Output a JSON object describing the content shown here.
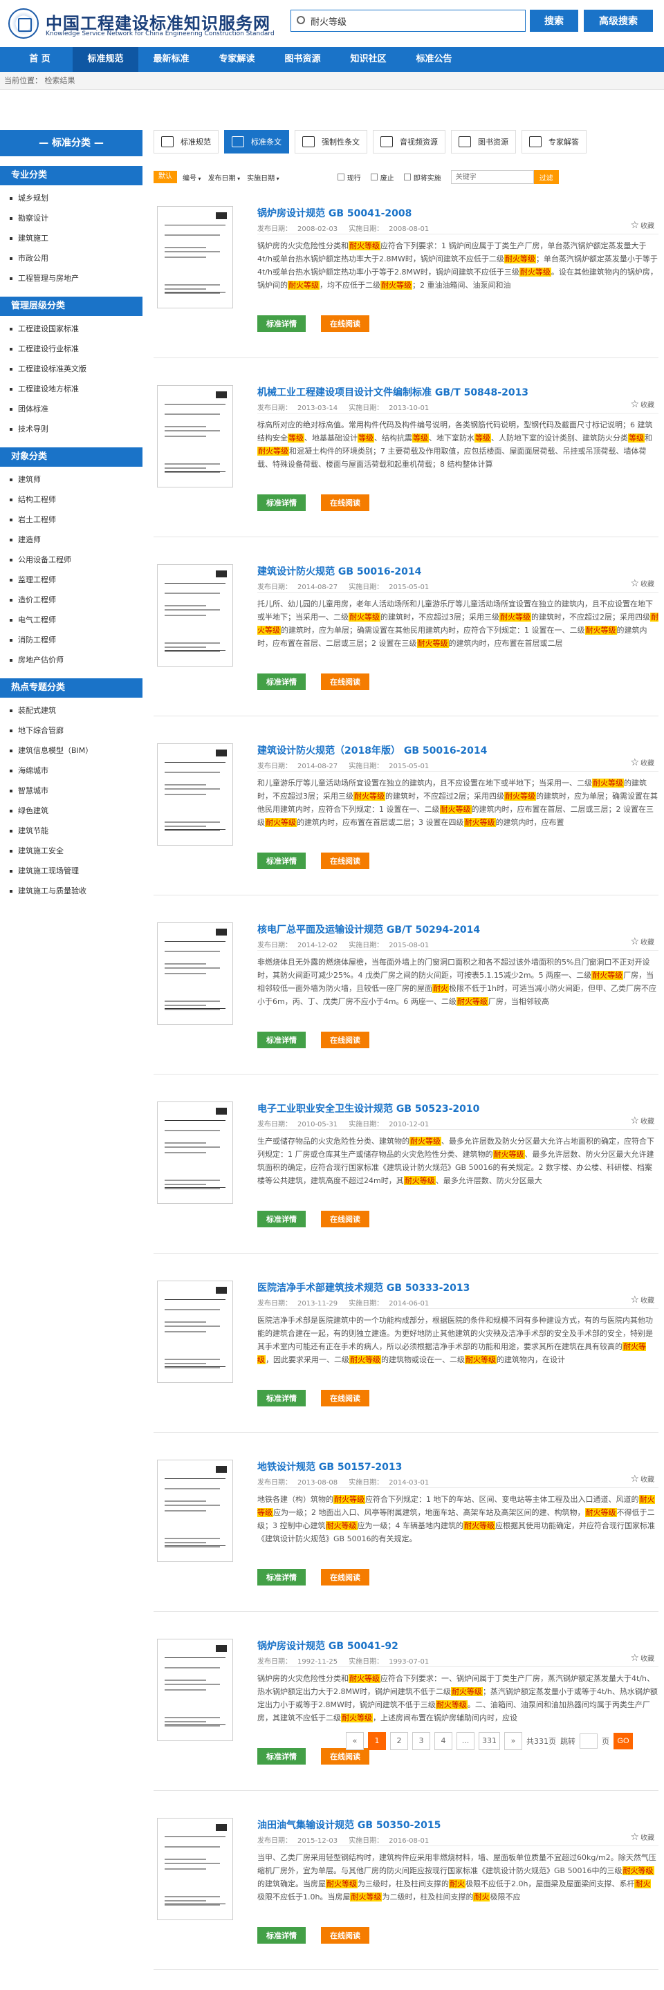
{
  "header": {
    "title": "中国工程建设标准知识服务网",
    "subtitle": "Knowledge Service Network for China Engineering Construction Standard",
    "search_value": "耐火等级",
    "search_btn": "搜索",
    "adv_btn": "高级搜索"
  },
  "nav": [
    "首 页",
    "标准规范",
    "最新标准",
    "专家解读",
    "图书资源",
    "知识社区",
    "标准公告"
  ],
  "breadcrumb": "当前位置： 检索结果",
  "sidebar": {
    "head": "— 标准分类 —",
    "groups": [
      {
        "name": "专业分类",
        "items": [
          "城乡规划",
          "勘察设计",
          "建筑施工",
          "市政公用",
          "工程管理与房地产"
        ]
      },
      {
        "name": "管理层级分类",
        "items": [
          "工程建设国家标准",
          "工程建设行业标准",
          "工程建设标准英文版",
          "工程建设地方标准",
          "团体标准",
          "技术导则"
        ]
      },
      {
        "name": "对象分类",
        "items": [
          "建筑师",
          "结构工程师",
          "岩土工程师",
          "建造师",
          "公用设备工程师",
          "监理工程师",
          "造价工程师",
          "电气工程师",
          "消防工程师",
          "房地产估价师"
        ]
      },
      {
        "name": "热点专题分类",
        "items": [
          "装配式建筑",
          "地下综合管廊",
          "建筑信息模型（BIM）",
          "海绵城市",
          "智慧城市",
          "绿色建筑",
          "建筑节能",
          "建筑施工安全",
          "建筑施工现场管理",
          "建筑施工与质量验收"
        ]
      }
    ]
  },
  "tabs": [
    "标准规范",
    "标准条文",
    "强制性条文",
    "音视频资源",
    "图书资源",
    "专家解答"
  ],
  "filter": {
    "default": "默认",
    "sort1": "编号",
    "sort2": "发布日期",
    "sort3": "实施日期",
    "c1": "现行",
    "c2": "废止",
    "c3": "即将实施",
    "placeholder": "关键字",
    "btn": "过滤"
  },
  "labels": {
    "pub": "发布日期：",
    "impl": "实施日期：",
    "fav": "收藏",
    "detail": "标准详情",
    "read": "在线阅读"
  },
  "results": [
    {
      "title": "锅炉房设计规范 GB 50041-2008",
      "pub": "2008-02-03",
      "impl": "2008-08-01",
      "abs": [
        "锅炉房的火灾危险性分类和",
        "耐火等级",
        "应符合下列要求：1 锅炉间应属于丁类生产厂房，单台蒸汽锅炉额定蒸发量大于4t/h或单台热水锅炉额定热功率大于2.8MW时，锅炉间建筑不应低于二级",
        "耐火等级",
        "；单台蒸汽锅炉额定蒸发量小于等于4t/h或单台热水锅炉额定热功率小于等于2.8MW时，锅炉间建筑不应低于三级",
        "耐火等级",
        "。设在其他建筑物内的锅炉房，锅炉间的",
        "耐火等级",
        "，均不应低于二级",
        "耐火等级",
        "；2 重油油箱间、油泵间和油"
      ]
    },
    {
      "title": "机械工业工程建设项目设计文件编制标准 GB/T 50848-2013",
      "pub": "2013-03-14",
      "impl": "2013-10-01",
      "abs": [
        "标高所对应的绝对标高值。常用构件代码及构件编号说明，各类钢筋代码说明，型钢代码及截面尺寸标记说明；6 建筑结构安全",
        "等级",
        "、地基基础设计",
        "等级",
        "、结构抗震",
        "等级",
        "、地下室防水",
        "等级",
        "、人防地下室的设计类别、建筑防火分类",
        "等级",
        "和",
        "耐火等级",
        "和混凝土构件的环境类别；7 主要荷载及作用取值，应包括楼面、屋面面层荷载、吊挂或吊顶荷载、墙体荷载、特殊设备荷载、楼面与屋面活荷载和起重机荷载；8 结构整体计算"
      ]
    },
    {
      "title": "建筑设计防火规范 GB 50016-2014",
      "pub": "2014-08-27",
      "impl": "2015-05-01",
      "abs": [
        "托儿所、幼儿园的儿童用房，老年人活动场所和儿童游乐厅等儿童活动场所宜设置在独立的建筑内，且不应设置在地下或半地下；当采用一、二级",
        "耐火等级",
        "的建筑时，不应超过3层；采用三级",
        "耐火等级",
        "的建筑时，不应超过2层；采用四级",
        "耐火等级",
        "的建筑时，应为单层；确需设置在其他民用建筑内时，应符合下列规定：1 设置在一、二级",
        "耐火等级",
        "的建筑内时，应布置在首层、二层或三层；2 设置在三级",
        "耐火等级",
        "的建筑内时，应布置在首层或二层"
      ]
    },
    {
      "title": "建筑设计防火规范（2018年版） GB 50016-2014",
      "pub": "2014-08-27",
      "impl": "2015-05-01",
      "abs": [
        "和儿童游乐厅等儿童活动场所宜设置在独立的建筑内，且不应设置在地下或半地下；当采用一、二级",
        "耐火等级",
        "的建筑时，不应超过3层；采用三级",
        "耐火等级",
        "的建筑时，不应超过2层；采用四级",
        "耐火等级",
        "的建筑时，应为单层；确需设置在其他民用建筑内时，应符合下列规定：1 设置在一、二级",
        "耐火等级",
        "的建筑内时，应布置在首层、二层或三层；2 设置在三级",
        "耐火等级",
        "的建筑内时，应布置在首层或二层；3 设置在四级",
        "耐火等级",
        "的建筑内时，应布置"
      ]
    },
    {
      "title": "核电厂总平面及运输设计规范 GB/T 50294-2014",
      "pub": "2014-12-02",
      "impl": "2015-08-01",
      "abs": [
        "非燃烧体且无外露的燃烧体屋檐，当每面外墙上的门窗洞口面积之和各不超过该外墙面积的5%且门窗洞口不正对开设时，其防火间距可减少25%。4 戊类厂房之间的防火间距，可按表5.1.15减少2m。5 两座一、二级",
        "耐火等级",
        "厂房，当相邻较低一面外墙为防火墙，且较低一座厂房的屋面",
        "耐火",
        "极限不低于1h时，可适当减小防火间距，但甲、乙类厂房不应小于6m，丙、丁、戊类厂房不应小于4m。6 两座一、二级",
        "耐火等级",
        "厂房，当相邻较高"
      ]
    },
    {
      "title": "电子工业职业安全卫生设计规范 GB 50523-2010",
      "pub": "2010-05-31",
      "impl": "2010-12-01",
      "abs": [
        "生产或储存物品的火灾危险性分类、建筑物的",
        "耐火等级",
        "、最多允许层数及防火分区最大允许占地面积的确定，应符合下列规定：1 厂房或仓库其生产或储存物品的火灾危险性分类、建筑物的",
        "耐火等级",
        "、最多允许层数、防火分区最大允许建筑面积的确定，应符合现行国家标准《建筑设计防火规范》GB 50016的有关规定。2 数字楼、办公楼、科研楼、档案楼等公共建筑，建筑高度不超过24m时，其",
        "耐火等级",
        "、最多允许层数、防火分区最大"
      ]
    },
    {
      "title": "医院洁净手术部建筑技术规范 GB 50333-2013",
      "pub": "2013-11-29",
      "impl": "2014-06-01",
      "abs": [
        "医院洁净手术部是医院建筑中的一个功能构成部分，根据医院的条件和规模不同有多种建设方式，有的与医院内其他功能的建筑合建在一起，有的则独立建造。为更好地防止其他建筑的火灾殃及洁净手术部的安全及手术部的安全，特别是其手术室内可能还有正在手术的病人，所以必须根据洁净手术部的功能和用途，要求其所在建筑在具有较高的",
        "耐火等级",
        "，因此要求采用一、二级",
        "耐火等级",
        "的建筑物或设在一、二级",
        "耐火等级",
        "的建筑物内，在设计"
      ]
    },
    {
      "title": "地铁设计规范 GB 50157-2013",
      "pub": "2013-08-08",
      "impl": "2014-03-01",
      "abs": [
        "地铁各建（构）筑物的",
        "耐火等级",
        "应符合下列规定：1 地下的车站、区间、变电站等主体工程及出入口通道、风道的",
        "耐火等级",
        "应为一级；2 地面出入口、风亭等附属建筑，地面车站、高架车站及高架区间的建、构筑物，",
        "耐火等级",
        "不得低于二级；3 控制中心建筑",
        "耐火等级",
        "应为一级；4 车辆基地内建筑的",
        "耐火等级",
        "应根据其使用功能确定，并应符合现行国家标准《建筑设计防火规范》GB 50016的有关规定。"
      ]
    },
    {
      "title": "锅炉房设计规范 GB 50041-92",
      "pub": "1992-11-25",
      "impl": "1993-07-01",
      "abs": [
        "锅炉房的火灾危险性分类和",
        "耐火等级",
        "应符合下列要求：一、锅炉间属于丁类生产厂房，蒸汽锅炉额定蒸发量大于4t/h、热水锅炉额定出力大于2.8MW时，锅炉间建筑不低于二级",
        "耐火等级",
        "；蒸汽锅炉额定蒸发量小于或等于4t/h、热水锅炉额定出力小于或等于2.8MW时，锅炉间建筑不低于三级",
        "耐火等级",
        "。二、油箱间、油泵间和油加热器间均属于丙类生产厂房，其建筑不应低于二级",
        "耐火等级",
        "，上述房间布置在锅炉房辅助间内时，应设"
      ]
    },
    {
      "title": "油田油气集输设计规范 GB 50350-2015",
      "pub": "2015-12-03",
      "impl": "2016-08-01",
      "abs": [
        "当甲、乙类厂房采用轻型钢结构时，建筑构件应采用非燃烧材料，墙、屋面板单位质量不宜超过60kg/m2。除天然气压缩机厂房外，宜为单层。与其他厂房的防火间距应按现行国家标准《建筑设计防火规范》GB 50016中的三级",
        "耐火等级",
        "的建筑确定。当房屋",
        "耐火等级",
        "为三级时，柱及柱间支撑的",
        "耐火",
        "极限不应低于2.0h，屋面梁及屋面梁间支撑、系杆",
        "耐火",
        "极限不应低于1.0h。当房屋",
        "耐火等级",
        "为二级时，柱及柱间支撑的",
        "耐火",
        "极限不应"
      ]
    }
  ],
  "pager": {
    "prev": "«",
    "pages": [
      "1",
      "2",
      "3",
      "4",
      "...",
      "331"
    ],
    "next": "»",
    "total": "共331页",
    "goto": "跳转",
    "page_unit": "页",
    "go": "GO"
  }
}
